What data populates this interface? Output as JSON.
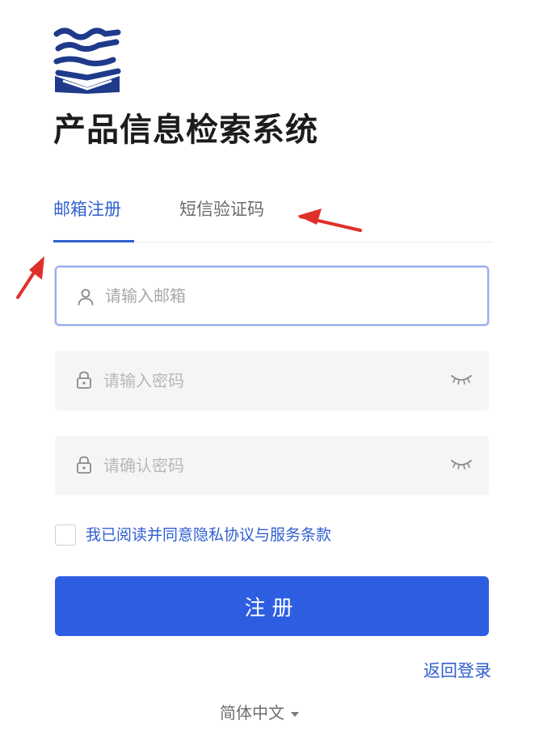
{
  "app": {
    "title": "产品信息检索系统",
    "logo_icon": "wave-book-logo",
    "brand_color": "#1f3a8a"
  },
  "tabs": [
    {
      "label": "邮箱注册",
      "active": true
    },
    {
      "label": "短信验证码",
      "active": false
    }
  ],
  "form": {
    "email": {
      "placeholder": "请输入邮箱",
      "value": "",
      "icon": "user-icon"
    },
    "password": {
      "placeholder": "请输入密码",
      "value": "",
      "icon": "lock-icon",
      "toggle_icon": "eye-closed-icon"
    },
    "confirm_password": {
      "placeholder": "请确认密码",
      "value": "",
      "icon": "lock-icon",
      "toggle_icon": "eye-closed-icon"
    },
    "agreement": {
      "label": "我已阅读并同意隐私协议与服务条款",
      "checked": false
    },
    "submit_label": "注册"
  },
  "footer": {
    "back_to_login": "返回登录",
    "language": "简体中文",
    "language_icon": "caret-down-icon"
  },
  "colors": {
    "accent": "#2f5fd0",
    "button": "#2d5ee2",
    "annotation_arrow": "#e0302a"
  }
}
